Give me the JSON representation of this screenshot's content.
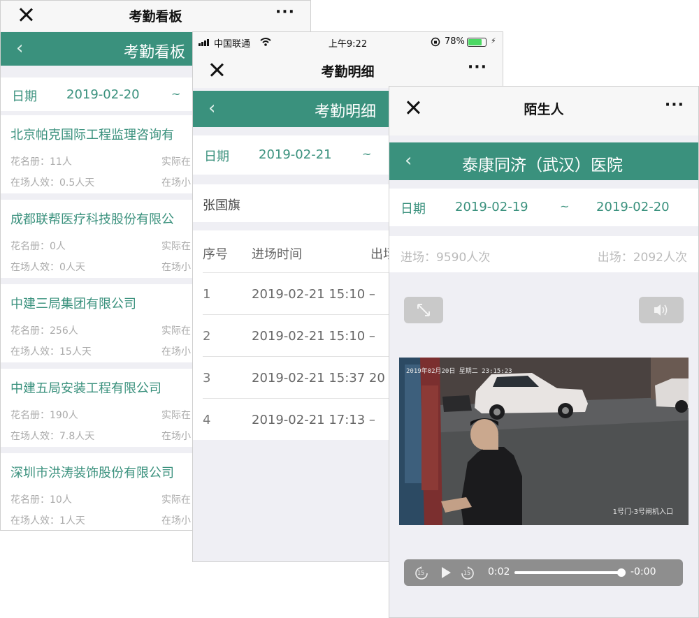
{
  "board": {
    "wx_title": "考勤看板",
    "more": "···",
    "header_title": "考勤看板",
    "date_label": "日期",
    "date_from": "2019-02-20",
    "tilde": "~",
    "companies": [
      {
        "name": "北京帕克国际工程监理咨询有",
        "roster": "花名册：11人",
        "efficiency": "在场人效：0.5人天",
        "right1": "实际在",
        "right2": "在场小"
      },
      {
        "name": "成都联帮医疗科技股份有限公",
        "roster": "花名册：0人",
        "efficiency": "在场人效：0人天",
        "right1": "实际在",
        "right2": "在场小"
      },
      {
        "name": "中建三局集团有限公司",
        "roster": "花名册：256人",
        "efficiency": "在场人效：15人天",
        "right1": "实际在",
        "right2": "在场小"
      },
      {
        "name": "中建五局安装工程有限公司",
        "roster": "花名册：190人",
        "efficiency": "在场人效：7.8人天",
        "right1": "实际在",
        "right2": "在场小"
      },
      {
        "name": "深圳市洪涛装饰股份有限公司",
        "roster": "花名册：10人",
        "efficiency": "在场人效：1人天",
        "right1": "实际在",
        "right2": "在场小"
      }
    ]
  },
  "detail": {
    "carrier": "中国联通",
    "time": "上午9:22",
    "battery": "78%",
    "battery_level": 0.78,
    "wx_title": "考勤明细",
    "more": "···",
    "header_title": "考勤明细",
    "date_label": "日期",
    "date_from": "2019-02-21",
    "tilde": "~",
    "person": "张国旗",
    "col_no": "序号",
    "col_in": "进场时间",
    "col_out": "出场",
    "rows": [
      {
        "no": "1",
        "time": "2019-02-21 15:10 –"
      },
      {
        "no": "2",
        "time": "2019-02-21 15:10 –"
      },
      {
        "no": "3",
        "time": "2019-02-21 15:37 20"
      },
      {
        "no": "4",
        "time": "2019-02-21 17:13 –"
      }
    ]
  },
  "stranger": {
    "wx_title": "陌生人",
    "more": "···",
    "header_title": "泰康同济（武汉）医院",
    "date_label": "日期",
    "date_from": "2019-02-19",
    "tilde": "~",
    "date_to": "2019-02-20",
    "entries": "进场：9590人次",
    "exits": "出场：2092人次",
    "video_timestamp": "2019年02月20日 星期二 23:15:23",
    "video_camera": "1号门-3号闸机入口",
    "player": {
      "current": "0:02",
      "remaining": "-0:00",
      "progress": 0.98,
      "skip_back": "15",
      "skip_fwd": "15"
    }
  }
}
